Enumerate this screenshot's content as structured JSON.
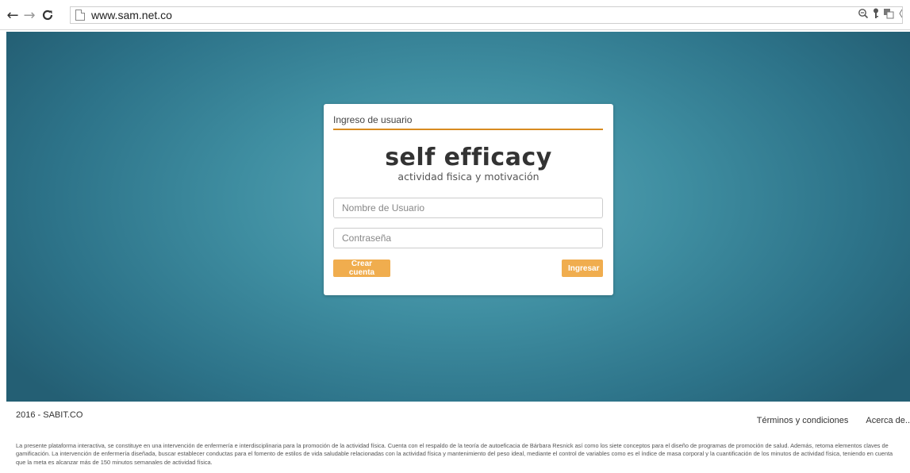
{
  "browser": {
    "back_glyph": "←",
    "forward_glyph": "→",
    "reload_glyph": "C",
    "url": "www.sam.net.co",
    "icons": [
      "zoom-icon",
      "key-icon",
      "translate-icon",
      "star-icon"
    ]
  },
  "login": {
    "card_title": "Ingreso de usuario",
    "brand_name": "self efficacy",
    "brand_tagline": "actividad fisica y motivación",
    "username_placeholder": "Nombre de Usuario",
    "password_placeholder": "Contraseña",
    "create_account_label": "Crear cuenta",
    "login_label": "Ingresar"
  },
  "footer": {
    "copyright": "2016 - SABIT.CO",
    "terms_link": "Términos y condiciones",
    "about_link": "Acerca de..",
    "disclaimer": "La presente plataforma interactiva, se constituye en una intervención de enfermería e interdisciplinaria para la promoción de la actividad física. Cuenta con el respaldo de la teoría de autoeficacia de Bárbara Resnick así como los siete conceptos para el diseño de programas de promoción de salud. Además, retoma elementos claves de gamificación. La intervención de enfermería diseñada, buscar establecer conductas para el fomento de estilos de vida saludable relacionadas con la actividad física y mantenimiento del peso ideal, mediante el control de variables como es el índice de masa corporal y la cuantificación de los minutos de actividad física, teniendo en cuenta que la meta es alcanzar más de 150 minutos semanales de actividad física."
  },
  "colors": {
    "accent": "#f0ad4e",
    "title_underline": "#d88b20",
    "hero": "#3f8ea1"
  }
}
